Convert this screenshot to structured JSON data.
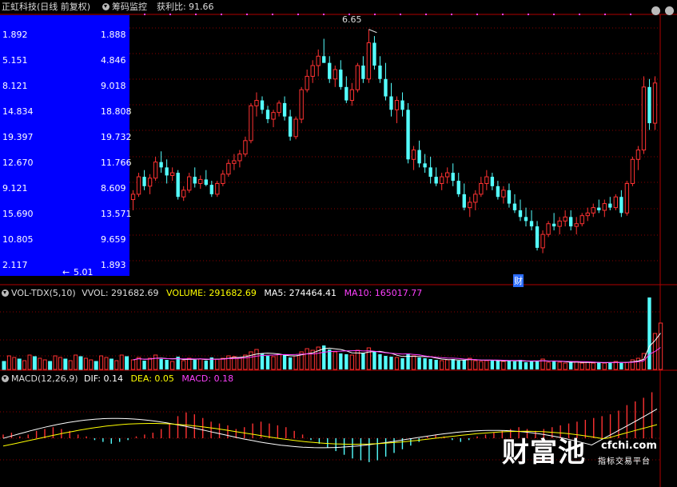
{
  "header": {
    "title": "正虹科技(日线 前复权)",
    "indicator": "筹码监控",
    "profit_label": "获利比:",
    "profit_value": "91.66"
  },
  "price_panel": {
    "high_marker": "6.65",
    "low_marker": "5.01",
    "finance_marker": "财",
    "left_values": [
      "1.892",
      "5.151",
      "8.121",
      "14.834",
      "19.397",
      "12.670",
      "9.121",
      "15.690",
      "10.805",
      "2.117"
    ],
    "right_values": [
      "1.888",
      "4.846",
      "9.018",
      "18.808",
      "19.732",
      "11.766",
      "8.609",
      "13.571",
      "9.659",
      "1.893"
    ]
  },
  "volume_panel": {
    "name": "VOL-TDX(5,10)",
    "vvol_label": "VVOL:",
    "vvol_value": "291682.69",
    "volume_label": "VOLUME:",
    "volume_value": "291682.69",
    "ma5_label": "MA5:",
    "ma5_value": "274464.41",
    "ma10_label": "MA10:",
    "ma10_value": "165017.77"
  },
  "macd_panel": {
    "name": "MACD(12,26,9)",
    "dif_label": "DIF:",
    "dif_value": "0.14",
    "dea_label": "DEA:",
    "dea_value": "0.05",
    "macd_label": "MACD:",
    "macd_value": "0.18"
  },
  "watermark": {
    "brand": "财富池",
    "domain": "cfchi.com",
    "tagline": "指标交易平台"
  },
  "colors": {
    "up": "#ff3232",
    "down": "#54ffff",
    "ma5": "#ffffff",
    "ma10": "#ff40ff",
    "dea": "#ffff00",
    "panel": "#0000ff",
    "grid": "#a00000"
  },
  "chart_data": {
    "type": "candlestick",
    "price_ylim": [
      4.9,
      6.75
    ],
    "candles": [
      [
        5.38,
        5.45,
        5.3,
        5.42
      ],
      [
        5.42,
        5.58,
        5.4,
        5.55
      ],
      [
        5.55,
        5.6,
        5.45,
        5.48
      ],
      [
        5.48,
        5.57,
        5.42,
        5.54
      ],
      [
        5.54,
        5.7,
        5.52,
        5.66
      ],
      [
        5.66,
        5.74,
        5.58,
        5.62
      ],
      [
        5.62,
        5.68,
        5.5,
        5.56
      ],
      [
        5.56,
        5.62,
        5.52,
        5.58
      ],
      [
        5.58,
        5.6,
        5.38,
        5.4
      ],
      [
        5.4,
        5.48,
        5.37,
        5.45
      ],
      [
        5.45,
        5.58,
        5.43,
        5.55
      ],
      [
        5.55,
        5.62,
        5.47,
        5.5
      ],
      [
        5.5,
        5.56,
        5.46,
        5.53
      ],
      [
        5.53,
        5.6,
        5.48,
        5.49
      ],
      [
        5.49,
        5.52,
        5.4,
        5.42
      ],
      [
        5.42,
        5.52,
        5.4,
        5.5
      ],
      [
        5.5,
        5.6,
        5.48,
        5.57
      ],
      [
        5.57,
        5.68,
        5.55,
        5.65
      ],
      [
        5.65,
        5.72,
        5.6,
        5.67
      ],
      [
        5.67,
        5.75,
        5.62,
        5.72
      ],
      [
        5.72,
        5.85,
        5.7,
        5.82
      ],
      [
        5.82,
        6.1,
        5.8,
        6.08
      ],
      [
        6.08,
        6.18,
        6.0,
        6.12
      ],
      [
        6.12,
        6.15,
        6.02,
        6.05
      ],
      [
        6.05,
        6.08,
        5.95,
        5.98
      ],
      [
        5.98,
        6.05,
        5.92,
        6.03
      ],
      [
        6.03,
        6.12,
        6.0,
        6.1
      ],
      [
        6.1,
        6.15,
        5.97,
        6.0
      ],
      [
        6.0,
        6.05,
        5.82,
        5.85
      ],
      [
        5.85,
        6.0,
        5.83,
        5.98
      ],
      [
        5.98,
        6.22,
        5.95,
        6.2
      ],
      [
        6.2,
        6.35,
        6.18,
        6.3
      ],
      [
        6.3,
        6.42,
        6.25,
        6.38
      ],
      [
        6.38,
        6.5,
        6.3,
        6.45
      ],
      [
        6.45,
        6.58,
        6.4,
        6.4
      ],
      [
        6.4,
        6.45,
        6.25,
        6.28
      ],
      [
        6.28,
        6.38,
        6.22,
        6.35
      ],
      [
        6.35,
        6.42,
        6.2,
        6.22
      ],
      [
        6.22,
        6.3,
        6.1,
        6.12
      ],
      [
        6.12,
        6.25,
        6.08,
        6.2
      ],
      [
        6.2,
        6.4,
        6.18,
        6.38
      ],
      [
        6.38,
        6.45,
        6.25,
        6.28
      ],
      [
        6.28,
        6.65,
        6.25,
        6.55
      ],
      [
        6.55,
        6.6,
        6.35,
        6.38
      ],
      [
        6.38,
        6.45,
        6.25,
        6.28
      ],
      [
        6.28,
        6.4,
        6.12,
        6.15
      ],
      [
        6.15,
        6.25,
        6.0,
        6.05
      ],
      [
        6.05,
        6.15,
        5.95,
        6.12
      ],
      [
        6.12,
        6.18,
        6.0,
        6.05
      ],
      [
        6.05,
        6.1,
        5.65,
        5.68
      ],
      [
        5.68,
        5.78,
        5.6,
        5.75
      ],
      [
        5.75,
        5.82,
        5.62,
        5.65
      ],
      [
        5.65,
        5.72,
        5.58,
        5.62
      ],
      [
        5.62,
        5.7,
        5.5,
        5.55
      ],
      [
        5.55,
        5.62,
        5.48,
        5.5
      ],
      [
        5.5,
        5.58,
        5.45,
        5.55
      ],
      [
        5.55,
        5.62,
        5.5,
        5.58
      ],
      [
        5.58,
        5.65,
        5.48,
        5.52
      ],
      [
        5.52,
        5.58,
        5.4,
        5.42
      ],
      [
        5.42,
        5.5,
        5.3,
        5.32
      ],
      [
        5.32,
        5.4,
        5.25,
        5.36
      ],
      [
        5.36,
        5.45,
        5.3,
        5.42
      ],
      [
        5.42,
        5.55,
        5.4,
        5.5
      ],
      [
        5.5,
        5.6,
        5.45,
        5.55
      ],
      [
        5.55,
        5.58,
        5.45,
        5.48
      ],
      [
        5.48,
        5.52,
        5.38,
        5.4
      ],
      [
        5.4,
        5.48,
        5.35,
        5.45
      ],
      [
        5.45,
        5.5,
        5.32,
        5.35
      ],
      [
        5.35,
        5.42,
        5.28,
        5.3
      ],
      [
        5.3,
        5.38,
        5.22,
        5.25
      ],
      [
        5.25,
        5.32,
        5.18,
        5.22
      ],
      [
        5.22,
        5.3,
        5.15,
        5.18
      ],
      [
        5.18,
        5.22,
        5.0,
        5.02
      ],
      [
        5.02,
        5.15,
        4.98,
        5.12
      ],
      [
        5.12,
        5.22,
        5.1,
        5.2
      ],
      [
        5.2,
        5.28,
        5.15,
        5.18
      ],
      [
        5.18,
        5.25,
        5.12,
        5.22
      ],
      [
        5.22,
        5.3,
        5.18,
        5.25
      ],
      [
        5.25,
        5.3,
        5.15,
        5.18
      ],
      [
        5.18,
        5.25,
        5.12,
        5.2
      ],
      [
        5.2,
        5.28,
        5.18,
        5.26
      ],
      [
        5.26,
        5.32,
        5.22,
        5.28
      ],
      [
        5.28,
        5.35,
        5.25,
        5.32
      ],
      [
        5.32,
        5.38,
        5.28,
        5.3
      ],
      [
        5.3,
        5.38,
        5.25,
        5.35
      ],
      [
        5.35,
        5.4,
        5.3,
        5.32
      ],
      [
        5.32,
        5.42,
        5.3,
        5.4
      ],
      [
        5.4,
        5.45,
        5.25,
        5.28
      ],
      [
        5.28,
        5.52,
        5.26,
        5.5
      ],
      [
        5.5,
        5.7,
        5.48,
        5.68
      ],
      [
        5.68,
        5.78,
        5.6,
        5.75
      ],
      [
        5.75,
        6.3,
        5.72,
        6.22
      ],
      [
        6.22,
        6.28,
        5.9,
        5.95
      ],
      [
        5.95,
        6.3,
        5.9,
        6.25
      ]
    ],
    "volume": [
      12,
      15,
      11,
      14,
      18,
      13,
      12,
      10,
      16,
      11,
      14,
      12,
      13,
      11,
      15,
      13,
      14,
      17,
      16,
      15,
      18,
      22,
      25,
      20,
      17,
      16,
      19,
      18,
      15,
      17,
      22,
      26,
      24,
      28,
      30,
      25,
      22,
      20,
      19,
      18,
      24,
      21,
      27,
      22,
      19,
      17,
      16,
      15,
      14,
      20,
      17,
      15,
      14,
      13,
      12,
      11,
      12,
      13,
      11,
      12,
      14,
      11,
      10,
      11,
      12,
      11,
      10,
      11,
      10,
      12,
      9,
      10,
      11,
      13,
      9,
      10,
      9,
      8,
      9,
      10,
      8,
      9,
      8,
      9,
      8,
      9,
      10,
      8,
      9,
      12,
      14,
      20,
      90,
      45,
      58
    ],
    "macd_hist": [
      0.02,
      0.03,
      0.01,
      0.02,
      0.04,
      0.05,
      0.06,
      0.05,
      0.04,
      0.02,
      0.01,
      -0.01,
      -0.02,
      -0.03,
      -0.02,
      -0.01,
      0.01,
      0.02,
      0.03,
      0.05,
      0.08,
      0.12,
      0.14,
      0.13,
      0.11,
      0.09,
      0.08,
      0.07,
      0.05,
      0.06,
      0.08,
      0.09,
      0.08,
      0.07,
      0.06,
      0.04,
      0.02,
      -0.01,
      -0.03,
      -0.05,
      -0.07,
      -0.09,
      -0.11,
      -0.12,
      -0.13,
      -0.12,
      -0.1,
      -0.08,
      -0.06,
      -0.04,
      -0.02,
      0.01,
      0.02,
      0.01,
      -0.01,
      -0.02,
      -0.01,
      0.01,
      0.02,
      0.03,
      0.04,
      0.05,
      0.06,
      0.05,
      0.04,
      0.05,
      0.06,
      0.07,
      0.08,
      0.09,
      0.1,
      0.11,
      0.12,
      0.13,
      0.15,
      0.18,
      0.2,
      0.22,
      0.25
    ]
  }
}
